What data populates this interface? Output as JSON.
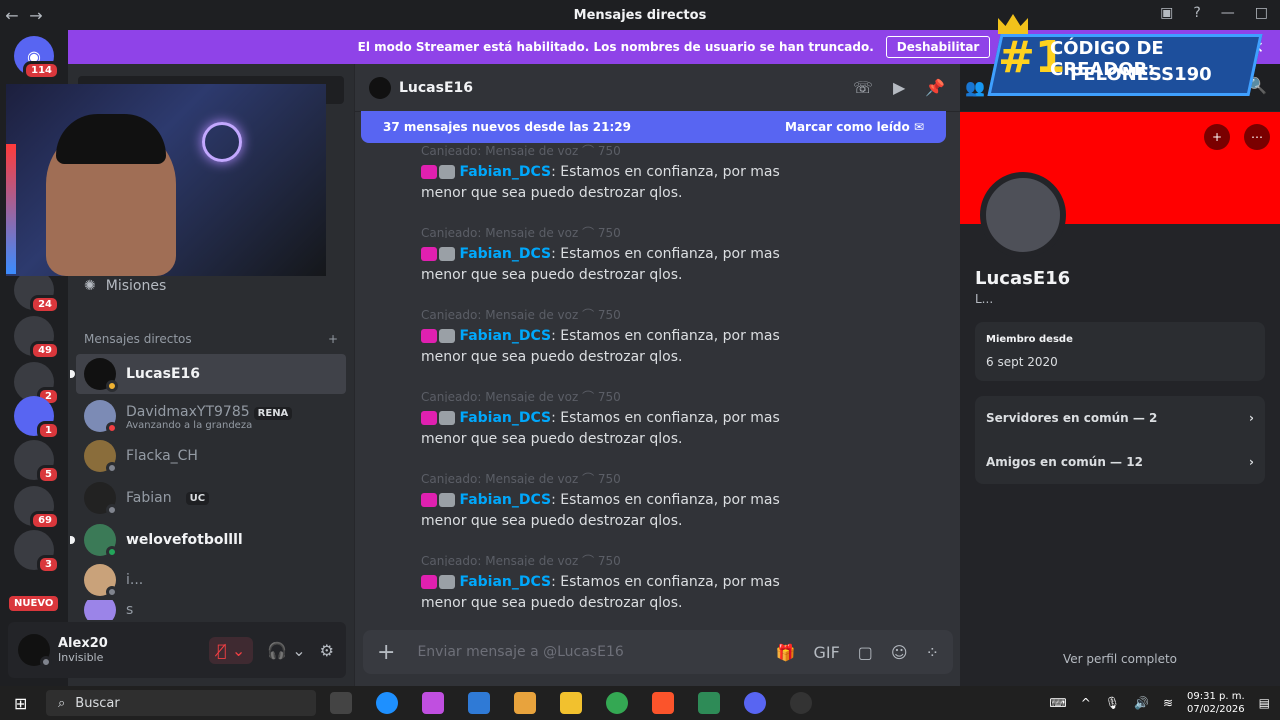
{
  "window": {
    "title": "Mensajes directos"
  },
  "banner": {
    "text": "El modo Streamer está habilitado. Los nombres de usuario se han truncado.",
    "button": "Deshabilitar"
  },
  "servers": {
    "home_badge": "114",
    "badges": [
      "24",
      "49",
      "2",
      "1",
      "5",
      "69",
      "3"
    ],
    "new_label": "NUEVO"
  },
  "sidebar": {
    "missions": "Misiones",
    "dm_header": "Mensajes directos",
    "dms": [
      {
        "name": "LucasE16",
        "sub": "",
        "tag": ""
      },
      {
        "name": "DavidmaxYT9785",
        "sub": "Avanzando a la grandeza",
        "tag": "RENA"
      },
      {
        "name": "Flacka_CH",
        "sub": "",
        "tag": ""
      },
      {
        "name": "Fabian",
        "sub": "",
        "tag": "UC"
      },
      {
        "name": "welovefotbollll",
        "sub": "",
        "tag": ""
      },
      {
        "name": "i...",
        "sub": "",
        "tag": ""
      },
      {
        "name": "s",
        "sub": "",
        "tag": ""
      }
    ]
  },
  "user": {
    "name": "Alex20",
    "status": "Invisible"
  },
  "chat": {
    "recipient": "LucasE16",
    "new_messages": "37 mensajes nuevos desde las 21:29",
    "mark_read": "Marcar como leído",
    "voice_line": "Canjeado: Mensaje de voz ⌒ 750",
    "mention": "Fabian_DCS",
    "message_text": ": Estamos en confianza, por mas menor que sea puedo destrozar qlos.",
    "composer_placeholder": "Enviar mensaje a @LucasE16"
  },
  "profile": {
    "name": "LucasE16",
    "sub": "L...",
    "member_since_label": "Miembro desde",
    "member_since": "6 sept 2020",
    "servers_common": "Servidores en común — 2",
    "friends_common": "Amigos en común — 12",
    "view_full": "Ver perfil completo"
  },
  "overlay": {
    "number": "#1",
    "line1": "CÓDIGO DE CREADOR:",
    "line2": "PELONESS190"
  },
  "taskbar": {
    "search": "Buscar",
    "time": "09:31 p. m.",
    "date": "07/02/2026"
  },
  "colors": {
    "accent": "#5865f2",
    "streamer_banner": "#8f43e8",
    "profile_banner": "#ff0000"
  }
}
